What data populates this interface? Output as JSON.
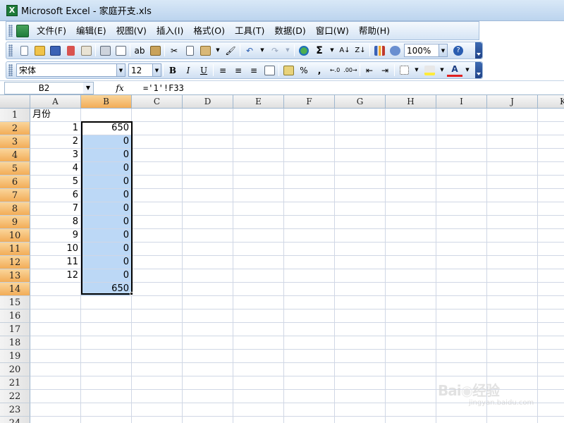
{
  "window": {
    "title": "Microsoft Excel - 家庭开支.xls",
    "app_icon": "excel-icon"
  },
  "menu": {
    "items": [
      "文件(F)",
      "编辑(E)",
      "视图(V)",
      "插入(I)",
      "格式(O)",
      "工具(T)",
      "数据(D)",
      "窗口(W)",
      "帮助(H)"
    ]
  },
  "standard_toolbar": {
    "zoom": "100%",
    "sum_glyph": "Σ"
  },
  "format_toolbar": {
    "font_name": "宋体",
    "font_size": "12",
    "bold": "B",
    "italic": "I",
    "underline": "U",
    "percent": "%",
    "comma": ","
  },
  "formula_bar": {
    "name_box": "B2",
    "fx": "fx",
    "formula": "='1'!F33"
  },
  "columns": [
    "A",
    "B",
    "C",
    "D",
    "E",
    "F",
    "G",
    "H",
    "I",
    "J",
    "K"
  ],
  "selected_column": "B",
  "rows": [
    "1",
    "2",
    "3",
    "4",
    "5",
    "6",
    "7",
    "8",
    "9",
    "10",
    "11",
    "12",
    "13",
    "14",
    "15",
    "16",
    "17",
    "18",
    "19",
    "20",
    "21",
    "22",
    "23",
    "24"
  ],
  "selected_rows": [
    "2",
    "3",
    "4",
    "5",
    "6",
    "7",
    "8",
    "9",
    "10",
    "11",
    "12",
    "13",
    "14"
  ],
  "cells": {
    "A1": "月份",
    "A2": "1",
    "A3": "2",
    "A4": "3",
    "A5": "4",
    "A6": "5",
    "A7": "6",
    "A8": "7",
    "A9": "8",
    "A10": "9",
    "A11": "10",
    "A12": "11",
    "A13": "12",
    "B2": "650",
    "B3": "0",
    "B4": "0",
    "B5": "0",
    "B6": "0",
    "B7": "0",
    "B8": "0",
    "B9": "0",
    "B10": "0",
    "B11": "0",
    "B12": "0",
    "B13": "0",
    "B14": "650"
  },
  "colors": {
    "selection_fill": "#bcd8f6",
    "header_selected": "#f2ac57",
    "title_bar": "#bcd4ee"
  }
}
